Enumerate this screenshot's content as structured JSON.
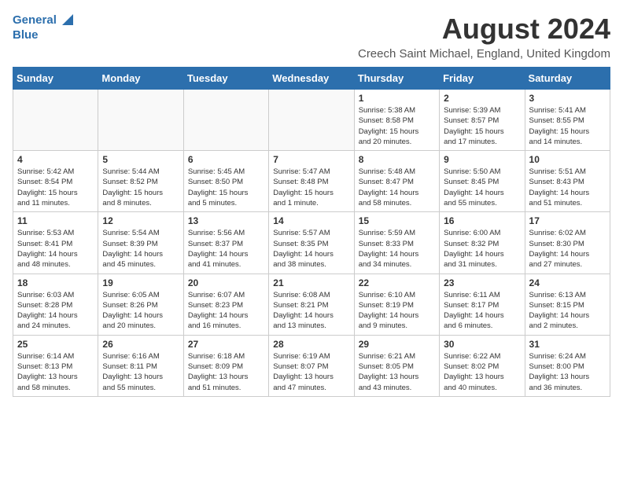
{
  "logo": {
    "line1": "General",
    "line2": "Blue"
  },
  "title": "August 2024",
  "subtitle": "Creech Saint Michael, England, United Kingdom",
  "days_of_week": [
    "Sunday",
    "Monday",
    "Tuesday",
    "Wednesday",
    "Thursday",
    "Friday",
    "Saturday"
  ],
  "weeks": [
    [
      {
        "day": "",
        "info": ""
      },
      {
        "day": "",
        "info": ""
      },
      {
        "day": "",
        "info": ""
      },
      {
        "day": "",
        "info": ""
      },
      {
        "day": "1",
        "info": "Sunrise: 5:38 AM\nSunset: 8:58 PM\nDaylight: 15 hours\nand 20 minutes."
      },
      {
        "day": "2",
        "info": "Sunrise: 5:39 AM\nSunset: 8:57 PM\nDaylight: 15 hours\nand 17 minutes."
      },
      {
        "day": "3",
        "info": "Sunrise: 5:41 AM\nSunset: 8:55 PM\nDaylight: 15 hours\nand 14 minutes."
      }
    ],
    [
      {
        "day": "4",
        "info": "Sunrise: 5:42 AM\nSunset: 8:54 PM\nDaylight: 15 hours\nand 11 minutes."
      },
      {
        "day": "5",
        "info": "Sunrise: 5:44 AM\nSunset: 8:52 PM\nDaylight: 15 hours\nand 8 minutes."
      },
      {
        "day": "6",
        "info": "Sunrise: 5:45 AM\nSunset: 8:50 PM\nDaylight: 15 hours\nand 5 minutes."
      },
      {
        "day": "7",
        "info": "Sunrise: 5:47 AM\nSunset: 8:48 PM\nDaylight: 15 hours\nand 1 minute."
      },
      {
        "day": "8",
        "info": "Sunrise: 5:48 AM\nSunset: 8:47 PM\nDaylight: 14 hours\nand 58 minutes."
      },
      {
        "day": "9",
        "info": "Sunrise: 5:50 AM\nSunset: 8:45 PM\nDaylight: 14 hours\nand 55 minutes."
      },
      {
        "day": "10",
        "info": "Sunrise: 5:51 AM\nSunset: 8:43 PM\nDaylight: 14 hours\nand 51 minutes."
      }
    ],
    [
      {
        "day": "11",
        "info": "Sunrise: 5:53 AM\nSunset: 8:41 PM\nDaylight: 14 hours\nand 48 minutes."
      },
      {
        "day": "12",
        "info": "Sunrise: 5:54 AM\nSunset: 8:39 PM\nDaylight: 14 hours\nand 45 minutes."
      },
      {
        "day": "13",
        "info": "Sunrise: 5:56 AM\nSunset: 8:37 PM\nDaylight: 14 hours\nand 41 minutes."
      },
      {
        "day": "14",
        "info": "Sunrise: 5:57 AM\nSunset: 8:35 PM\nDaylight: 14 hours\nand 38 minutes."
      },
      {
        "day": "15",
        "info": "Sunrise: 5:59 AM\nSunset: 8:33 PM\nDaylight: 14 hours\nand 34 minutes."
      },
      {
        "day": "16",
        "info": "Sunrise: 6:00 AM\nSunset: 8:32 PM\nDaylight: 14 hours\nand 31 minutes."
      },
      {
        "day": "17",
        "info": "Sunrise: 6:02 AM\nSunset: 8:30 PM\nDaylight: 14 hours\nand 27 minutes."
      }
    ],
    [
      {
        "day": "18",
        "info": "Sunrise: 6:03 AM\nSunset: 8:28 PM\nDaylight: 14 hours\nand 24 minutes."
      },
      {
        "day": "19",
        "info": "Sunrise: 6:05 AM\nSunset: 8:26 PM\nDaylight: 14 hours\nand 20 minutes."
      },
      {
        "day": "20",
        "info": "Sunrise: 6:07 AM\nSunset: 8:23 PM\nDaylight: 14 hours\nand 16 minutes."
      },
      {
        "day": "21",
        "info": "Sunrise: 6:08 AM\nSunset: 8:21 PM\nDaylight: 14 hours\nand 13 minutes."
      },
      {
        "day": "22",
        "info": "Sunrise: 6:10 AM\nSunset: 8:19 PM\nDaylight: 14 hours\nand 9 minutes."
      },
      {
        "day": "23",
        "info": "Sunrise: 6:11 AM\nSunset: 8:17 PM\nDaylight: 14 hours\nand 6 minutes."
      },
      {
        "day": "24",
        "info": "Sunrise: 6:13 AM\nSunset: 8:15 PM\nDaylight: 14 hours\nand 2 minutes."
      }
    ],
    [
      {
        "day": "25",
        "info": "Sunrise: 6:14 AM\nSunset: 8:13 PM\nDaylight: 13 hours\nand 58 minutes."
      },
      {
        "day": "26",
        "info": "Sunrise: 6:16 AM\nSunset: 8:11 PM\nDaylight: 13 hours\nand 55 minutes."
      },
      {
        "day": "27",
        "info": "Sunrise: 6:18 AM\nSunset: 8:09 PM\nDaylight: 13 hours\nand 51 minutes."
      },
      {
        "day": "28",
        "info": "Sunrise: 6:19 AM\nSunset: 8:07 PM\nDaylight: 13 hours\nand 47 minutes."
      },
      {
        "day": "29",
        "info": "Sunrise: 6:21 AM\nSunset: 8:05 PM\nDaylight: 13 hours\nand 43 minutes."
      },
      {
        "day": "30",
        "info": "Sunrise: 6:22 AM\nSunset: 8:02 PM\nDaylight: 13 hours\nand 40 minutes."
      },
      {
        "day": "31",
        "info": "Sunrise: 6:24 AM\nSunset: 8:00 PM\nDaylight: 13 hours\nand 36 minutes."
      }
    ]
  ]
}
